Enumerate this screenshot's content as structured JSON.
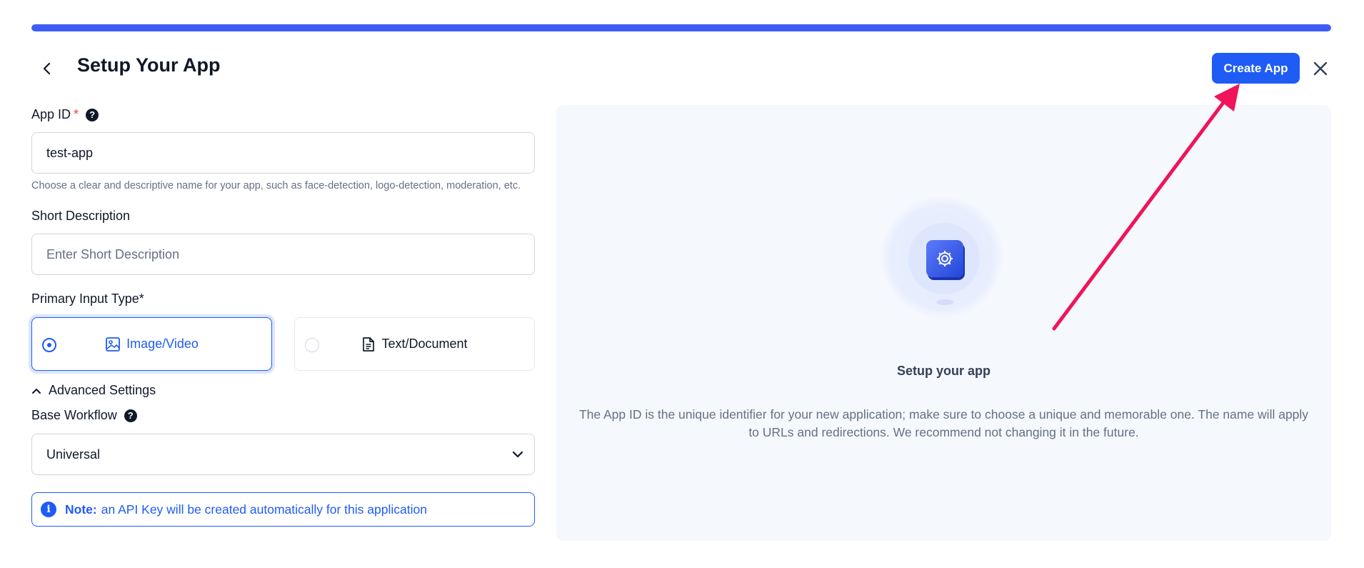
{
  "header": {
    "title": "Setup Your App",
    "create_button_label": "Create App",
    "progress": 1.0
  },
  "form": {
    "app_id": {
      "label": "App ID",
      "required_marker": "*",
      "help_icon": "?",
      "value": "test-app",
      "hint": "Choose a clear and descriptive name for your app, such as face-detection, logo-detection, moderation, etc."
    },
    "short_description": {
      "label": "Short Description",
      "placeholder": "Enter Short Description"
    },
    "primary_input": {
      "label": "Primary Input Type*",
      "options": [
        {
          "label": "Image/Video",
          "icon": "image-icon",
          "selected": true
        },
        {
          "label": "Text/Document",
          "icon": "document-icon",
          "selected": false
        }
      ]
    },
    "advanced_settings": {
      "label": "Advanced Settings",
      "expanded": true
    },
    "base_workflow": {
      "label": "Base Workflow",
      "help_icon": "?",
      "value": "Universal"
    },
    "note": {
      "icon": "i",
      "strong": "Note:",
      "text": "an API Key will be created automatically for this application"
    }
  },
  "preview": {
    "title": "Setup your app",
    "description": "The App ID is the unique identifier for your new application; make sure to choose a unique and memorable one. The name will apply to URLs and redirections. We recommend not changing it in the future."
  },
  "colors": {
    "accent": "#1f5cf5",
    "annotation_arrow": "#f0145a",
    "panel_bg": "#f5f8fd"
  }
}
